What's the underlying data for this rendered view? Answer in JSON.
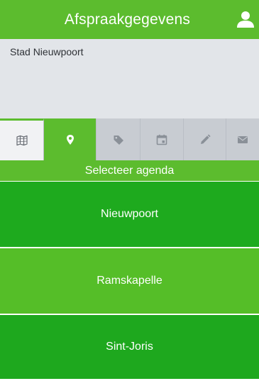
{
  "header": {
    "title": "Afspraakgegevens",
    "user_icon": "user-icon"
  },
  "info": {
    "organization": "Stad Nieuwpoort"
  },
  "tabs": [
    {
      "icon": "map-icon",
      "state": "outlined"
    },
    {
      "icon": "location-pin-icon",
      "state": "active"
    },
    {
      "icon": "tag-icon",
      "state": "inactive"
    },
    {
      "icon": "calendar-icon",
      "state": "inactive"
    },
    {
      "icon": "pencil-icon",
      "state": "inactive"
    },
    {
      "icon": "envelope-icon",
      "state": "inactive"
    }
  ],
  "section": {
    "title": "Selecteer agenda"
  },
  "agendas": [
    {
      "label": "Nieuwpoort"
    },
    {
      "label": "Ramskapelle"
    },
    {
      "label": "Sint-Joris"
    }
  ],
  "colors": {
    "brand_green": "#5cbc2e",
    "dark_green": "#1eaa1e",
    "panel_gray": "#e2e5e9",
    "tab_gray": "#c8ccd2"
  }
}
